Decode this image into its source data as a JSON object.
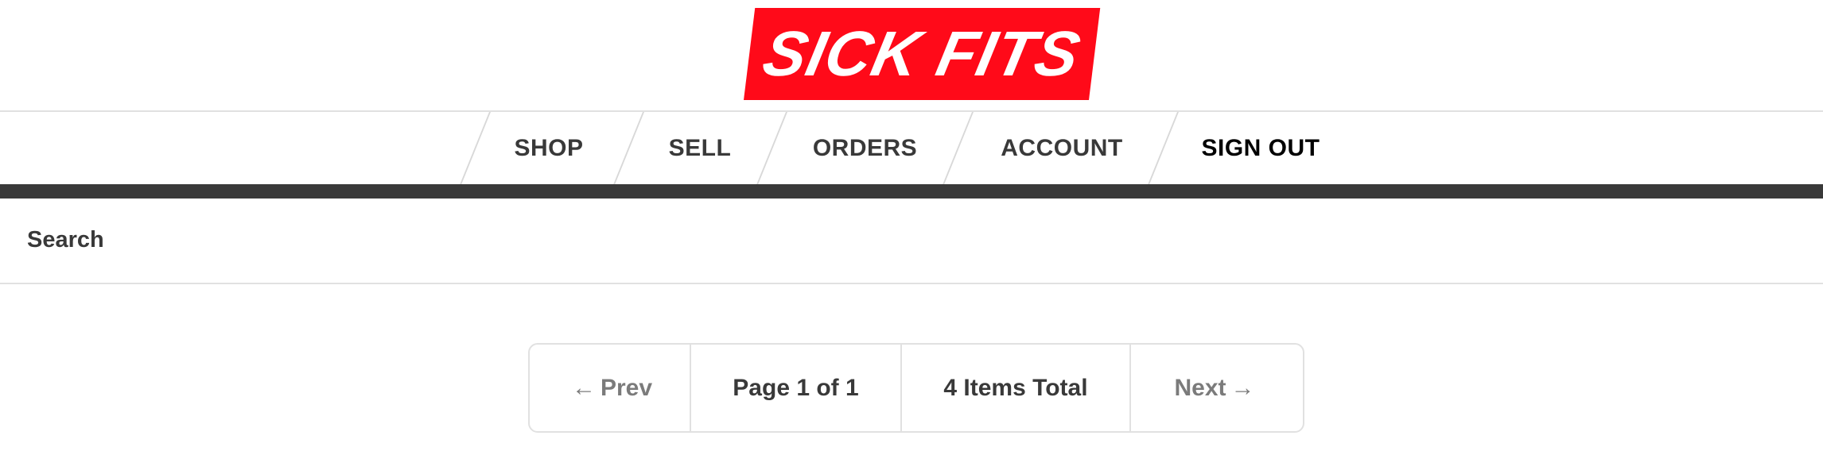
{
  "header": {
    "logo_text": "SICK FITS"
  },
  "nav": {
    "items": [
      {
        "label": "SHOP"
      },
      {
        "label": "SELL"
      },
      {
        "label": "ORDERS"
      },
      {
        "label": "ACCOUNT"
      },
      {
        "label": "SIGN OUT"
      }
    ]
  },
  "search": {
    "label": "Search",
    "value": "",
    "placeholder": ""
  },
  "pagination": {
    "prev_arrow": "←",
    "prev_label": "Prev",
    "page_text": "Page 1 of 1",
    "total_text": "4 Items Total",
    "next_label": "Next",
    "next_arrow": "→"
  },
  "colors": {
    "brand_red": "#ff0a19",
    "dark_bar": "#393939",
    "text": "#393939",
    "disabled_text": "#7b7b7b",
    "border": "#e1e1e1"
  }
}
